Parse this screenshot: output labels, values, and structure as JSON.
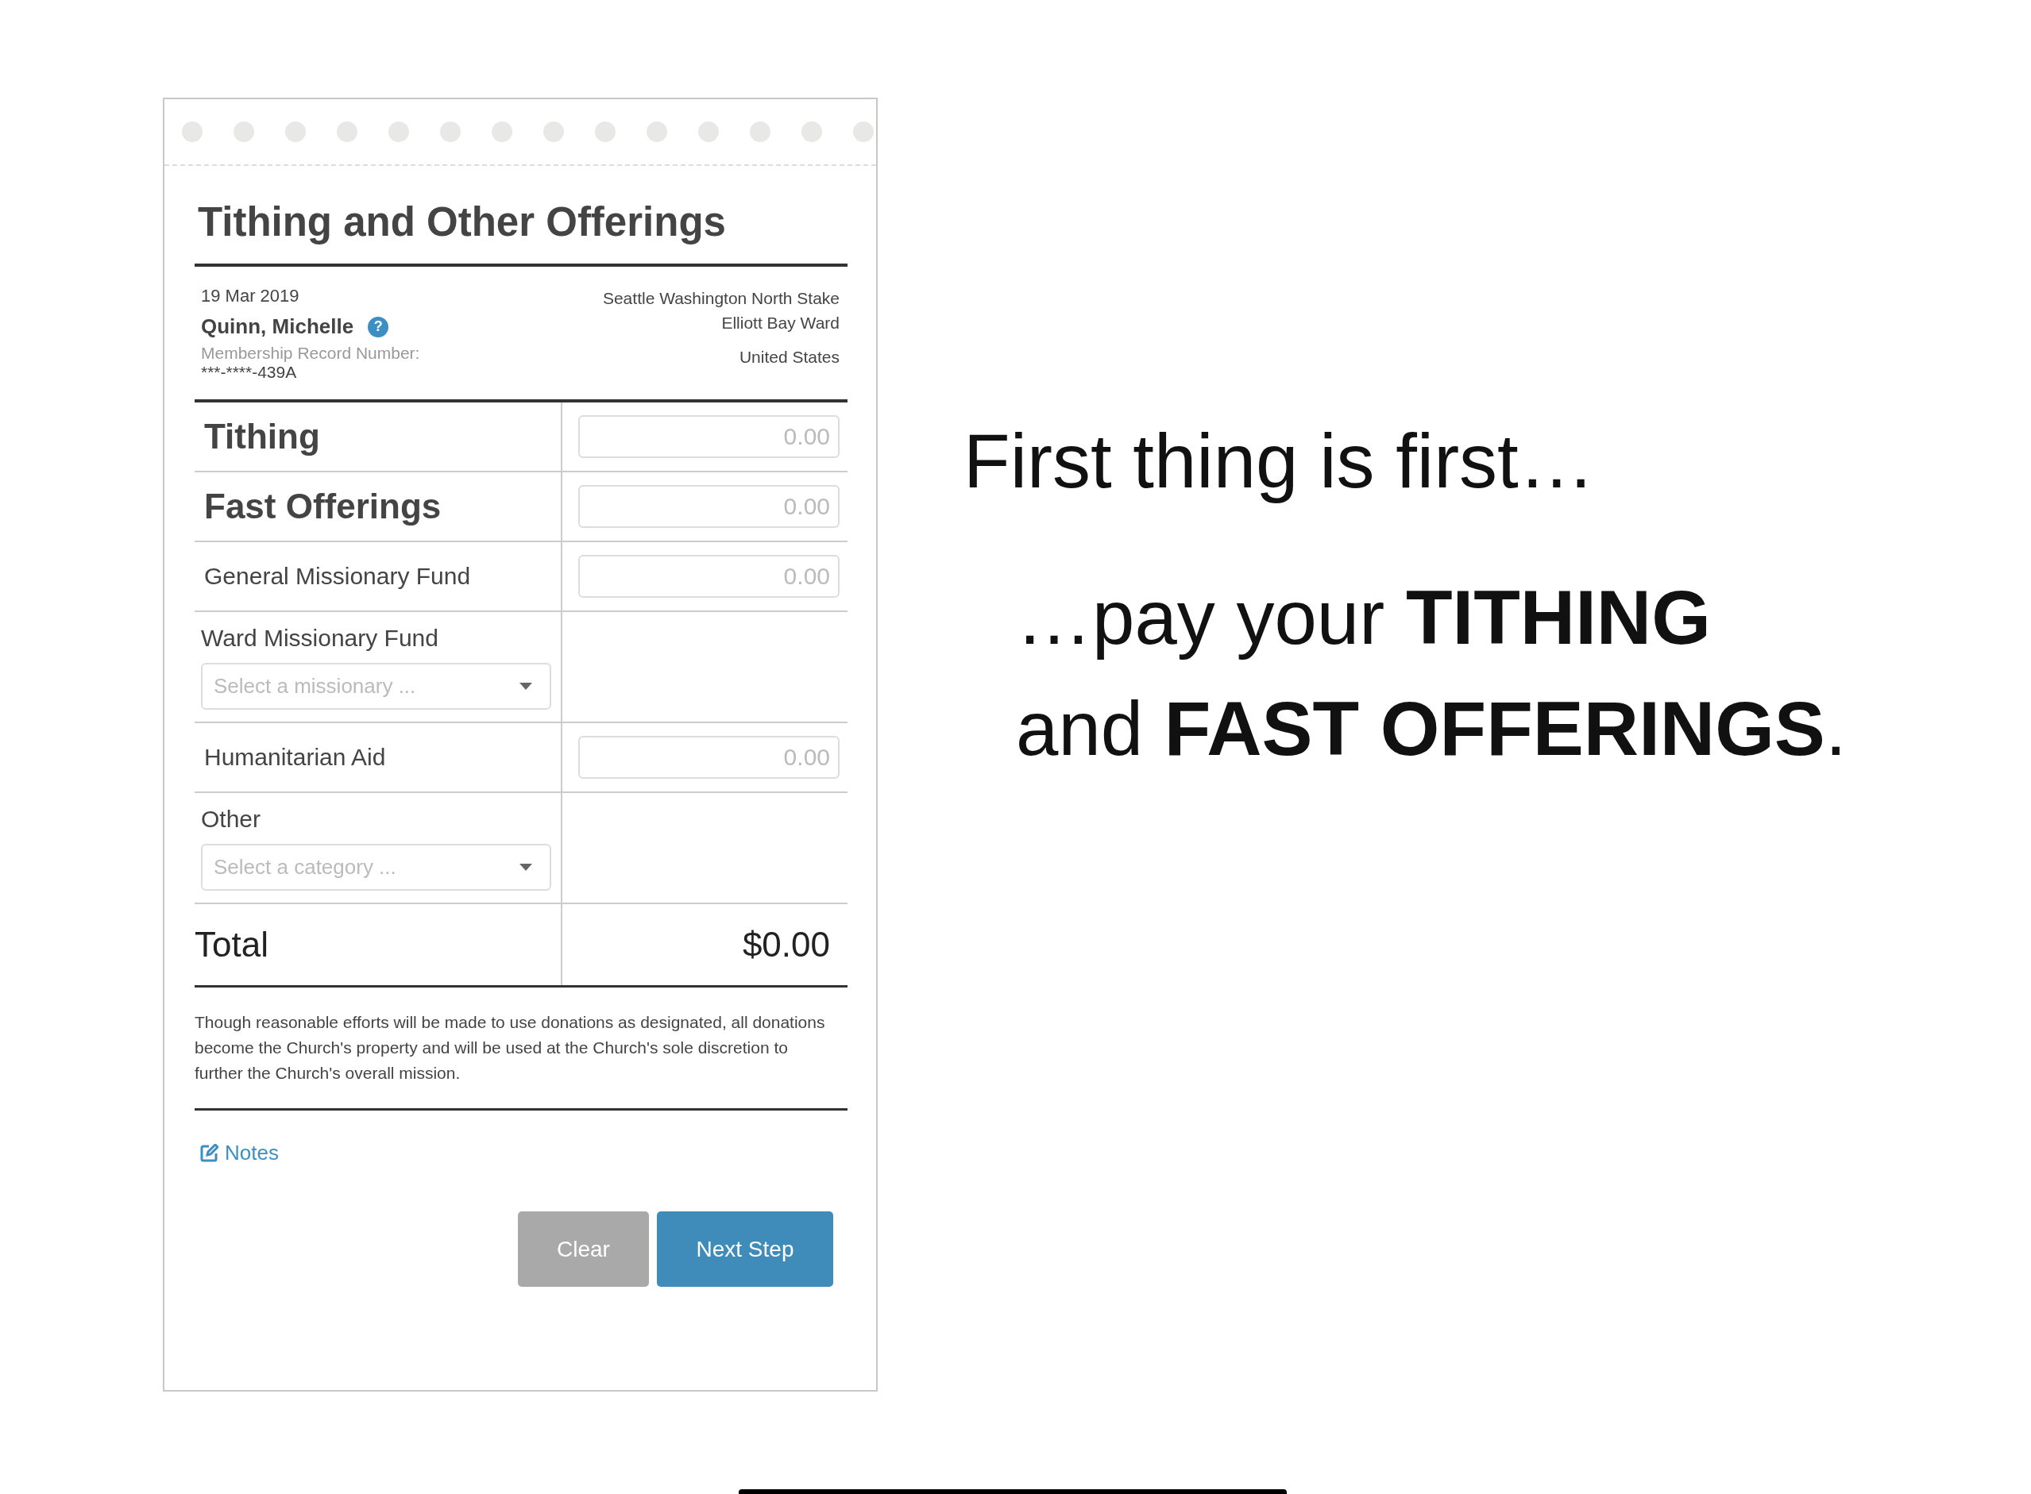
{
  "form": {
    "title": "Tithing and Other Offerings",
    "date": "19 Mar 2019",
    "member_name": "Quinn, Michelle",
    "help": "?",
    "record_label": "Membership Record Number:",
    "record_number": "***-****-439A",
    "location": [
      "Seattle Washington North Stake",
      "Elliott Bay Ward",
      "United States"
    ],
    "funds": [
      {
        "kind": "major",
        "label": "Tithing",
        "placeholder": "0.00"
      },
      {
        "kind": "major",
        "label": "Fast Offerings",
        "placeholder": "0.00"
      },
      {
        "kind": "amount",
        "label": "General Missionary Fund",
        "placeholder": "0.00"
      },
      {
        "kind": "select",
        "label": "Ward Missionary Fund",
        "placeholder": "Select a missionary ..."
      },
      {
        "kind": "amount",
        "label": "Humanitarian Aid",
        "placeholder": "0.00"
      },
      {
        "kind": "select",
        "label": "Other",
        "placeholder": "Select a category ..."
      }
    ],
    "total_label": "Total",
    "total": "$0.00",
    "disclaimer": "Though reasonable efforts will be made to use donations as designated, all donations become the Church's property and will be used at the Church's sole discretion to further the Church's overall mission.",
    "notes": "Notes",
    "buttons": [
      {
        "kind": "secondary",
        "label": "Clear"
      },
      {
        "kind": "primary",
        "label": "Next Step"
      }
    ]
  },
  "slide": {
    "heading": "First thing is first…",
    "lines": [
      "…pay your **TITHING**",
      "and **FAST OFFERINGS**."
    ]
  }
}
